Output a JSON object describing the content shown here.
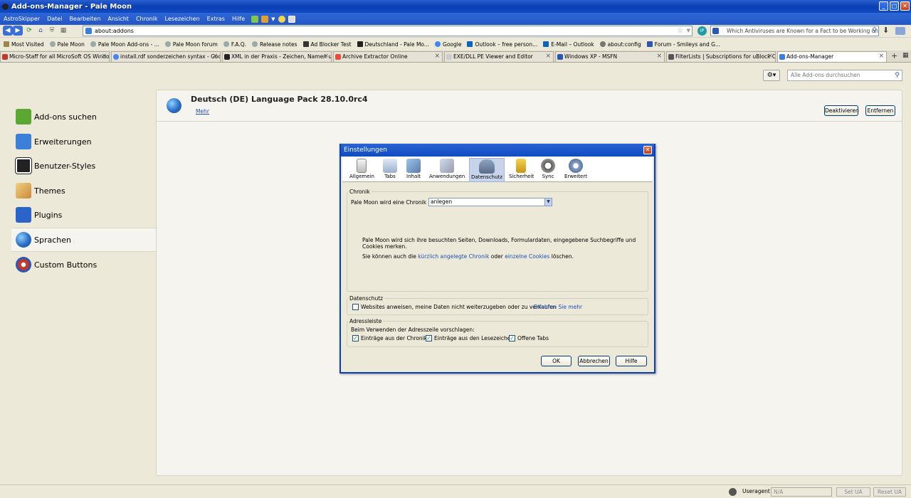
{
  "window": {
    "title": "Add-ons-Manager - Pale Moon"
  },
  "menu": [
    "AstroSkipper",
    "Datei",
    "Bearbeiten",
    "Ansicht",
    "Chronik",
    "Lesezeichen",
    "Extras",
    "Hilfe"
  ],
  "nav": {
    "url": "about:addons",
    "search": "Which Antiviruses are Known for a Fact to be Working on XP S"
  },
  "bookmarks": [
    "Most Visited",
    "Pale Moon",
    "Pale Moon Add-ons - ...",
    "Pale Moon forum",
    "F.A.Q.",
    "Release notes",
    "Ad Blocker Test",
    "Deutschland - Pale Mo...",
    "Google",
    "Outlook – free person...",
    "E-Mail – Outlook",
    "about:config",
    "Forum - Smileys and G..."
  ],
  "tabs": [
    {
      "label": "Micro-Staff for all MicroSoft OS Windows"
    },
    {
      "label": "install.rdf sonderzeichen syntax - Google"
    },
    {
      "label": "XML in der Praxis - Zeichen, Namen und"
    },
    {
      "label": "Archive Extractor Online"
    },
    {
      "label": "EXE/DLL PE Viewer and Editor"
    },
    {
      "label": "Windows XP - MSFN"
    },
    {
      "label": "FilterLists | Subscriptions for uBlock Origin"
    },
    {
      "label": "Add-ons-Manager"
    }
  ],
  "addons_search_placeholder": "Alle Add-ons durchsuchen",
  "categories": [
    {
      "label": "Add-ons suchen",
      "color": "#5aa832"
    },
    {
      "label": "Erweiterungen",
      "color": "#3b7fd9"
    },
    {
      "label": "Benutzer-Styles",
      "color": "#222222"
    },
    {
      "label": "Themes",
      "color": "#c9a04a"
    },
    {
      "label": "Plugins",
      "color": "#2a64c8"
    },
    {
      "label": "Sprachen",
      "color": "#2a8fd0"
    },
    {
      "label": "Custom Buttons",
      "color": "#c0392b"
    }
  ],
  "detail": {
    "title": "Deutsch (DE) Language Pack  28.10.0rc4",
    "more": "Mehr",
    "deactivate": "Deaktivieren",
    "remove": "Entfernen"
  },
  "dialog": {
    "title": "Einstellungen",
    "panes": [
      "Allgemein",
      "Tabs",
      "Inhalt",
      "Anwendungen",
      "Datenschutz",
      "Sicherheit",
      "Sync",
      "Erweitert"
    ],
    "selected_pane": "Datenschutz",
    "chronik": {
      "group": "Chronik",
      "label": "Pale Moon wird eine Chronik (E):",
      "value": "anlegen",
      "info": "Pale Moon wird sich ihre besuchten Seiten, Downloads, Formulardaten, eingegebene Suchbegriffe und Cookies merken.",
      "clear_prefix": "Sie können auch die",
      "clear_link1": "kürzlich angelegte Chronik",
      "clear_middle": "oder",
      "clear_link2": "einzelne Cookies",
      "clear_suffix": "löschen."
    },
    "datenschutz": {
      "group": "Datenschutz",
      "checkbox": "Websites anweisen, meine Daten nicht weiterzugeben oder zu verkaufen",
      "checked": false,
      "link": "Erfahren Sie mehr"
    },
    "adressleiste": {
      "group": "Adressleiste",
      "label": "Beim Verwenden der Adresszeile vorschlagen:",
      "options": [
        {
          "label": "Einträge aus der Chronik",
          "checked": true
        },
        {
          "label": "Einträge aus den Lesezeichen",
          "checked": true
        },
        {
          "label": "Offene Tabs",
          "checked": true
        }
      ]
    },
    "buttons": {
      "ok": "OK",
      "cancel": "Abbrechen",
      "help": "Hilfe"
    }
  },
  "statusbar": {
    "useragent_label": "Useragent",
    "useragent_value": "N/A",
    "set_ua": "Set UA",
    "reset_ua": "Reset UA"
  }
}
